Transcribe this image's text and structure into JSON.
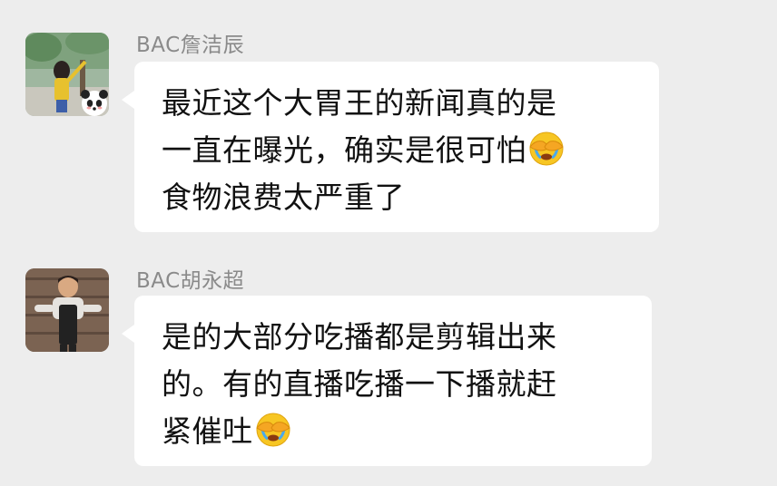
{
  "messages": [
    {
      "sender": "BAC詹洁辰",
      "avatar_icon": "person-photo-panda-avatar",
      "lines": [
        "最近这个大胃王的新闻真的是",
        "一直在曝光，确实是很可怕",
        "食物浪费太严重了"
      ],
      "emoji": "face-palm-crying-emoji"
    },
    {
      "sender": "BAC胡永超",
      "avatar_icon": "child-photo-avatar",
      "lines": [
        "是的大部分吃播都是剪辑出来",
        "的。有的直播吃播一下播就赶",
        "紧催吐"
      ],
      "emoji": "face-palm-crying-emoji"
    }
  ],
  "colors": {
    "background": "#ededed",
    "bubble": "#ffffff",
    "sender_text": "#8a8a8a",
    "message_text": "#111111"
  }
}
